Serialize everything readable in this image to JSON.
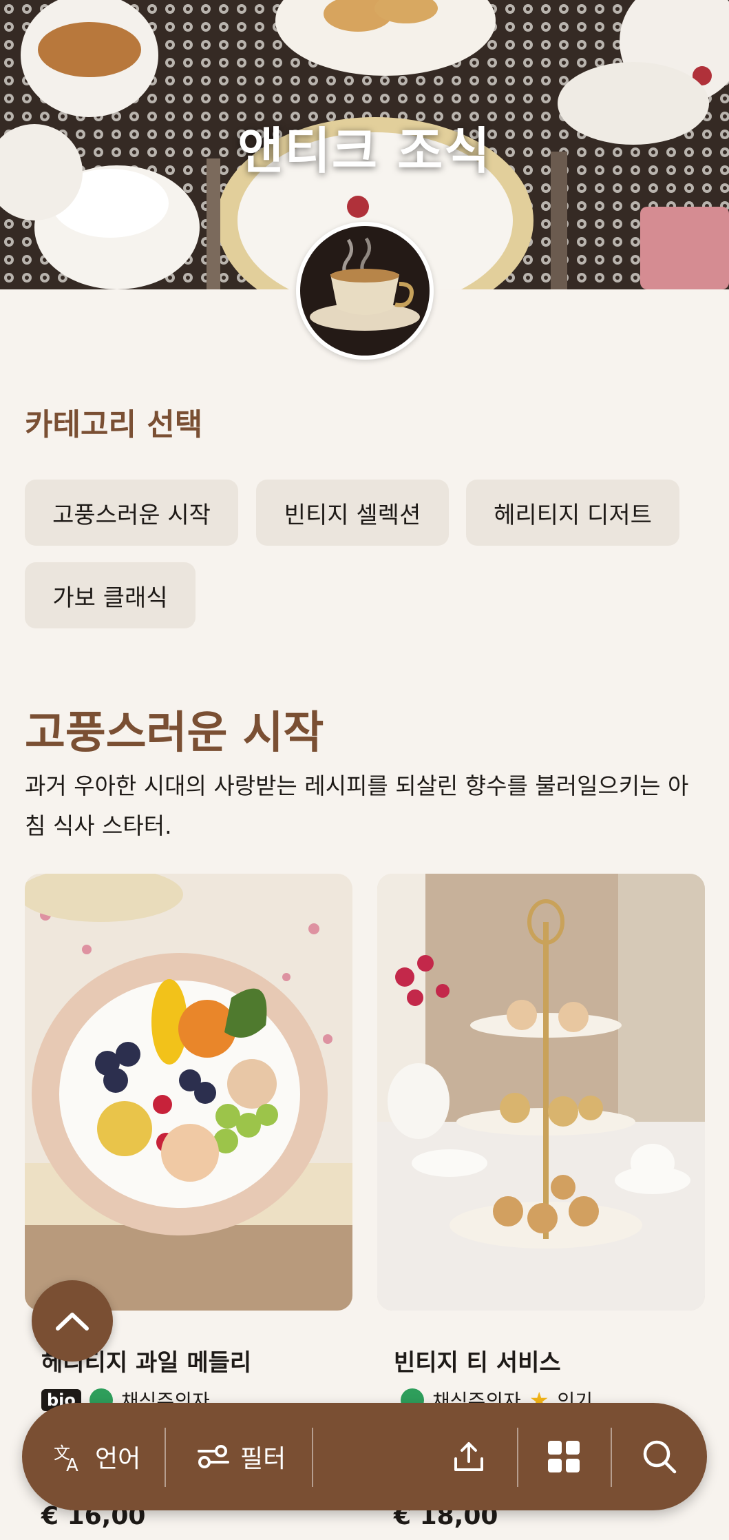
{
  "hero": {
    "title": "앤티크 조식"
  },
  "categories_section": {
    "label": "카테고리 선택",
    "chips": [
      "고풍스러운 시작",
      "빈티지 셀렉션",
      "헤리티지 디저트",
      "가보 클래식"
    ]
  },
  "category": {
    "title": "고풍스러운 시작",
    "description": "과거 우아한 시대의 사랑받는 레시피를 되살린 향수를 불러일으키는 아침 식사 스타터."
  },
  "products": [
    {
      "name": "헤리티지 과일 메들리",
      "bio_badge": "bio",
      "veg_label": "채식주의자",
      "price": "€ 16,00"
    },
    {
      "name": "빈티지 티 서비스",
      "veg_label": "채식주의자",
      "popular_label": "인기",
      "price": "€ 18,00"
    }
  ],
  "bottom_bar": {
    "language_label": "언어",
    "filter_label": "필터"
  },
  "colors": {
    "accent": "#7a4f33",
    "background": "#f7f3ee",
    "chip": "#ebe5dd"
  }
}
